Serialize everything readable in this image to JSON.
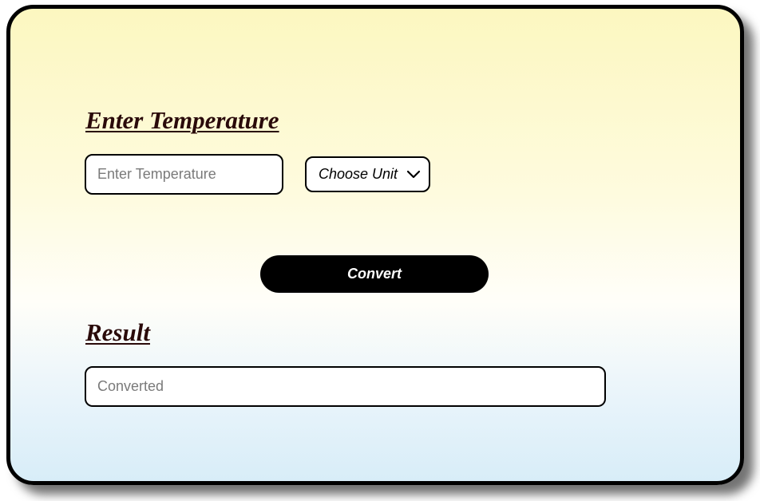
{
  "converter": {
    "input_heading": "Enter Temperature",
    "temperature_placeholder": "Enter Temperature",
    "temperature_value": "",
    "unit_select_value": "Choose Unit",
    "unit_select_icon": "chevron-down-icon",
    "convert_label": "Convert",
    "result_heading": "Result",
    "result_placeholder": "Converted",
    "result_value": ""
  }
}
